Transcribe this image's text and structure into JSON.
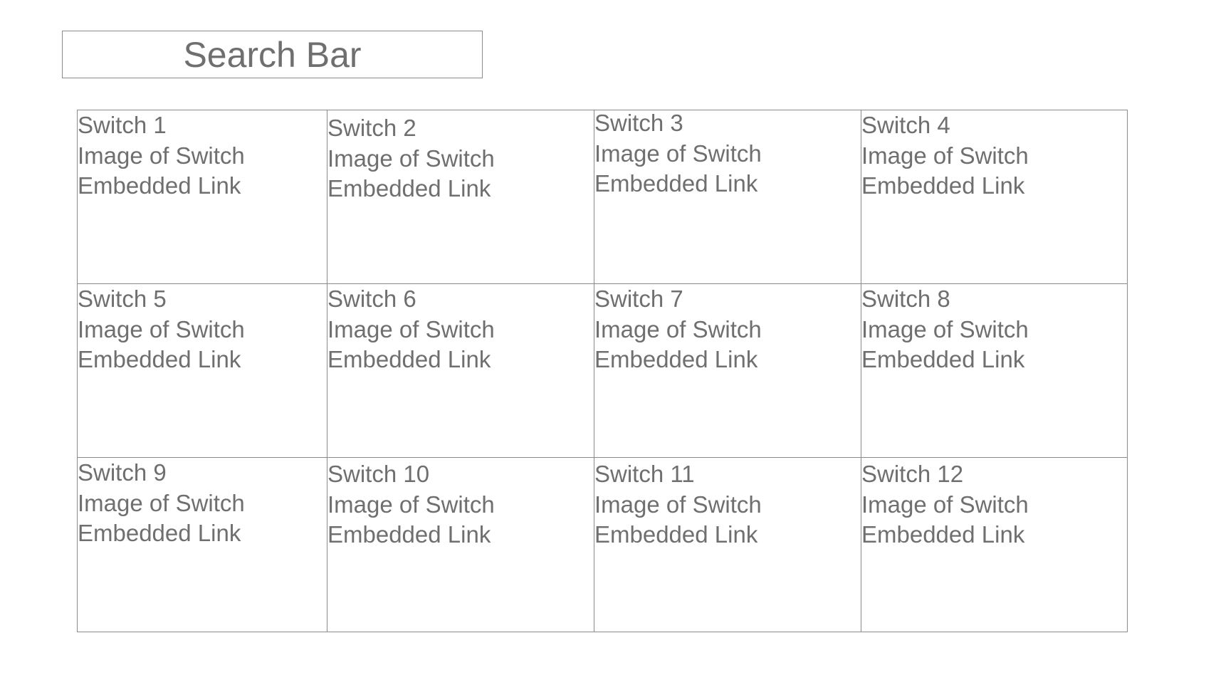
{
  "search": {
    "label": "Search Bar"
  },
  "switches": [
    {
      "title": "Switch 1",
      "image": "Image of Switch",
      "link": "Embedded Link"
    },
    {
      "title": "Switch 2",
      "image": "Image of Switch",
      "link": "Embedded Link"
    },
    {
      "title": "Switch 3",
      "image": "Image of Switch",
      "link": "Embedded Link"
    },
    {
      "title": "Switch 4",
      "image": "Image of Switch",
      "link": "Embedded Link"
    },
    {
      "title": "Switch 5",
      "image": "Image of Switch",
      "link": "Embedded Link"
    },
    {
      "title": "Switch 6",
      "image": "Image of Switch",
      "link": "Embedded Link"
    },
    {
      "title": "Switch 7",
      "image": "Image of Switch",
      "link": "Embedded Link"
    },
    {
      "title": "Switch 8",
      "image": "Image of Switch",
      "link": "Embedded Link"
    },
    {
      "title": "Switch 9",
      "image": "Image of Switch",
      "link": "Embedded Link"
    },
    {
      "title": "Switch 10",
      "image": "Image of Switch",
      "link": "Embedded Link"
    },
    {
      "title": "Switch 11",
      "image": "Image of Switch",
      "link": "Embedded Link"
    },
    {
      "title": "Switch 12",
      "image": "Image of Switch",
      "link": "Embedded Link"
    }
  ],
  "colors": {
    "text": "#6f6f6f",
    "border": "#8a8a8a",
    "background": "#ffffff"
  }
}
